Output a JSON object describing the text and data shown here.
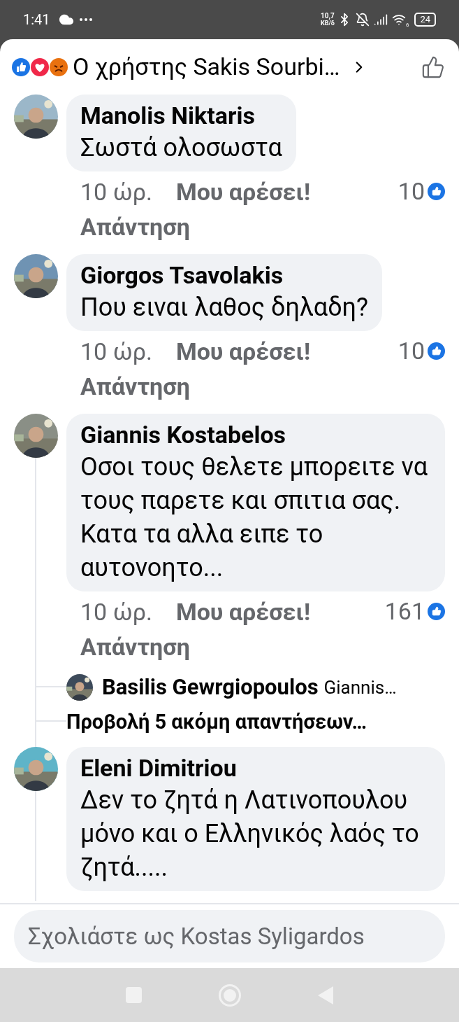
{
  "status_bar": {
    "time": "1:41",
    "network_speed": "10,7",
    "network_unit": "KB/δ",
    "wifi_badge": "6",
    "battery": "24"
  },
  "header": {
    "title": "Ο χρήστης Sakis Sourbi…"
  },
  "comments": [
    {
      "author": "Manolis Niktaris",
      "text": "Σωστά ολοσωστα",
      "time": "10 ώρ.",
      "like_label": "Μου αρέσει!",
      "reply_label": "Απάντηση",
      "like_count": "10",
      "has_thread": false
    },
    {
      "author": "Giorgos Tsavolakis",
      "text": "Που ειναι λαθος δηλαδη?",
      "time": "10 ώρ.",
      "like_label": "Μου αρέσει!",
      "reply_label": "Απάντηση",
      "like_count": "10",
      "has_thread": false
    },
    {
      "author": "Giannis Kostabelos",
      "text": "Οσοι τους θελετε μπορειτε να τους παρετε και σπιτια σας. Κατα τα αλλα ειπε το αυτονοητο...",
      "time": "10 ώρ.",
      "like_label": "Μου αρέσει!",
      "reply_label": "Απάντηση",
      "like_count": "161",
      "has_thread": true,
      "replies": [
        {
          "author": "Basilis Gewrgiopoulos",
          "text": "Giannis…"
        }
      ],
      "more_replies": "Προβολή 5 ακόμη απαντήσεων…"
    },
    {
      "author": "Eleni Dimitriou",
      "text": "Δεν το ζητά η Λατινοπουλου μόνο και ο Ελληνικός  λαός το ζητά.....",
      "has_thread": true
    }
  ],
  "composer": {
    "placeholder": "Σχολιάστε ως Kostas Syligardos"
  }
}
